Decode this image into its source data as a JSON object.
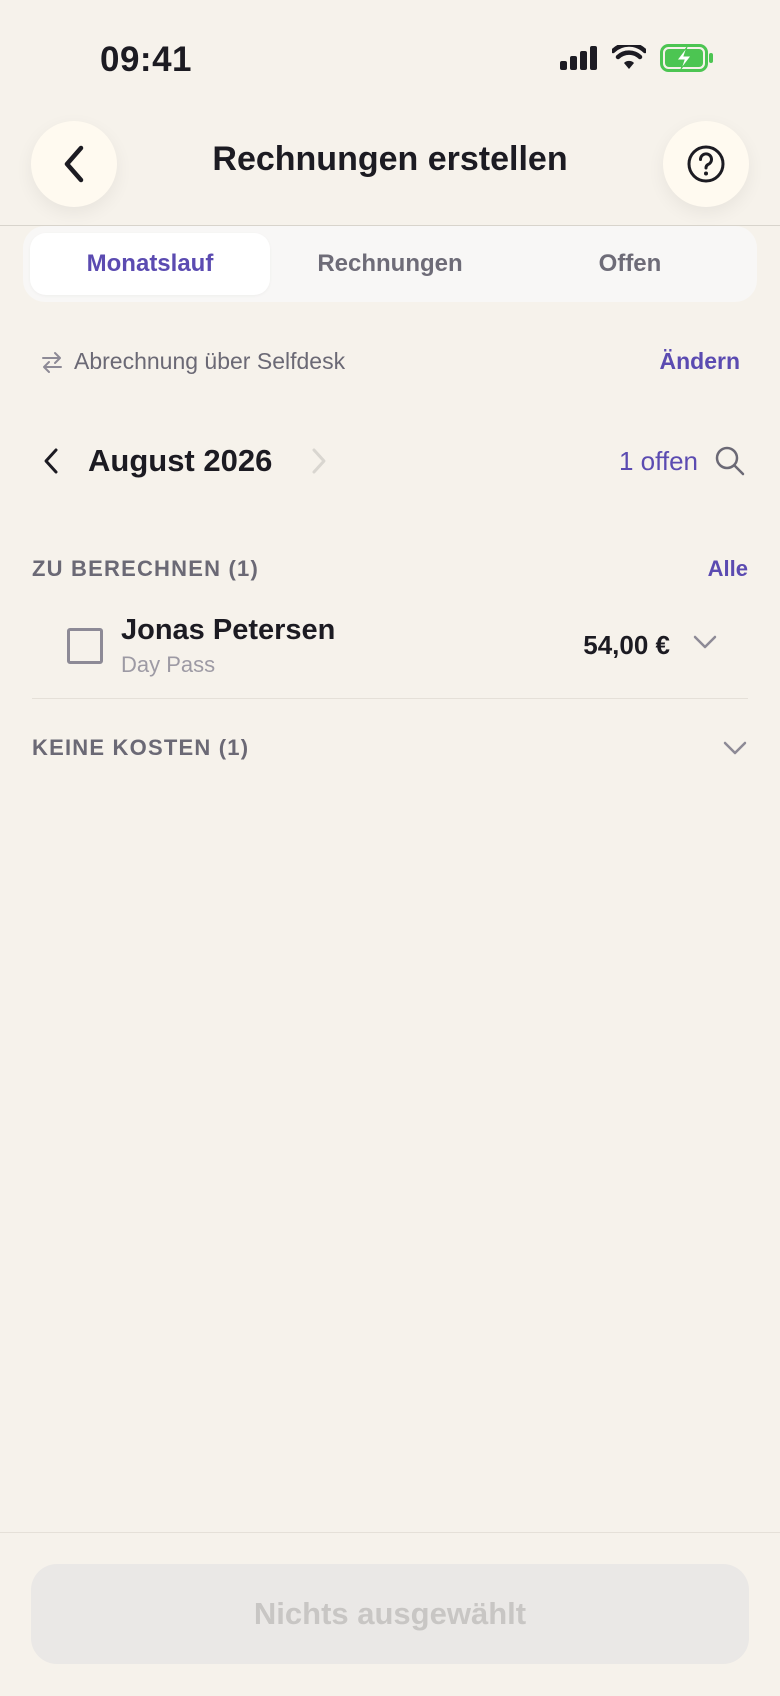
{
  "status_bar": {
    "time": "09:41"
  },
  "header": {
    "title": "Rechnungen erstellen"
  },
  "tabs": [
    {
      "label": "Monatslauf",
      "active": true
    },
    {
      "label": "Rechnungen",
      "active": false
    },
    {
      "label": "Offen",
      "active": false
    }
  ],
  "billing": {
    "text": "Abrechnung über Selfdesk",
    "change_label": "Ändern"
  },
  "month_nav": {
    "month": "August 2026",
    "open_count": "1 offen"
  },
  "sections": {
    "to_bill": {
      "title": "ZU BERECHNEN (1)",
      "all_label": "Alle",
      "items": [
        {
          "name": "Jonas Petersen",
          "subtitle": "Day Pass",
          "amount": "54,00 €",
          "checked": false
        }
      ]
    },
    "no_cost": {
      "title": "KEINE KOSTEN (1)"
    }
  },
  "footer": {
    "cta_label": "Nichts ausgewählt"
  },
  "colors": {
    "accent": "#5b4bb1",
    "background": "#f6f2eb",
    "battery": "#4cc552"
  }
}
